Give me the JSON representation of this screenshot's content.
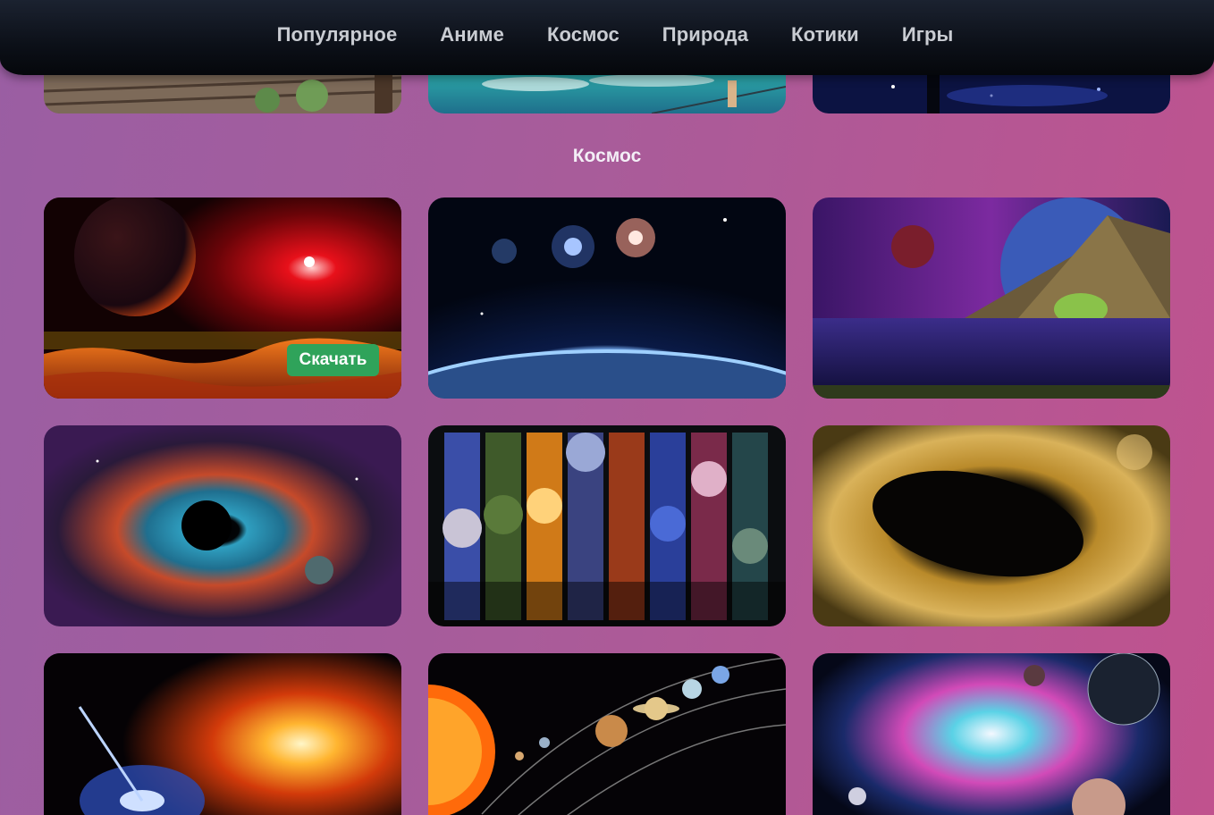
{
  "nav": {
    "items": [
      {
        "label": "Популярное"
      },
      {
        "label": "Аниме"
      },
      {
        "label": "Космос"
      },
      {
        "label": "Природа"
      },
      {
        "label": "Котики"
      },
      {
        "label": "Игры"
      }
    ]
  },
  "section": {
    "title": "Космос"
  },
  "gallery": {
    "download_label": "Скачать"
  },
  "colors": {
    "background_start": "#9a5ea3",
    "background_end": "#c0528e",
    "navbar": "#0c1018",
    "download_button": "#2fa35a"
  }
}
